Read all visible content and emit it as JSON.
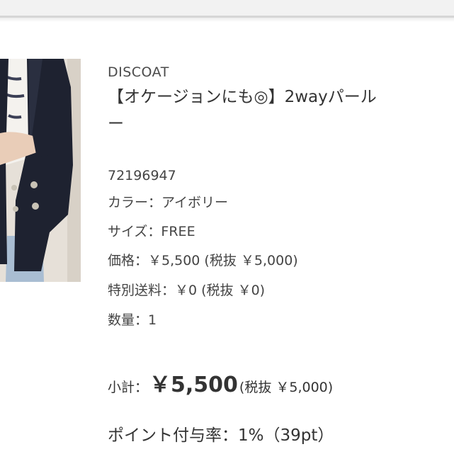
{
  "product": {
    "brand": "DISCOAT",
    "title_line1": "【オケージョンにも◎】2wayパール",
    "title_line2": "ー",
    "item_number": "72196947",
    "color": "カラー：アイボリー",
    "size": "サイズ：FREE",
    "price": "価格：￥5,500 (税抜 ￥5,000)",
    "shipping": "特別送料：￥0 (税抜 ￥0)",
    "quantity": "数量：1"
  },
  "summary": {
    "subtotal_label": "小計：",
    "subtotal_amount": "￥5,500",
    "subtotal_tax": "(税抜 ￥5,000)",
    "points": "ポイント付与率：1%（39pt）"
  },
  "colors": {
    "text": "#333333",
    "top_bar": "#f2f2f2",
    "photo_jacket": "#1e2230",
    "photo_background": "#e9e4dd"
  }
}
